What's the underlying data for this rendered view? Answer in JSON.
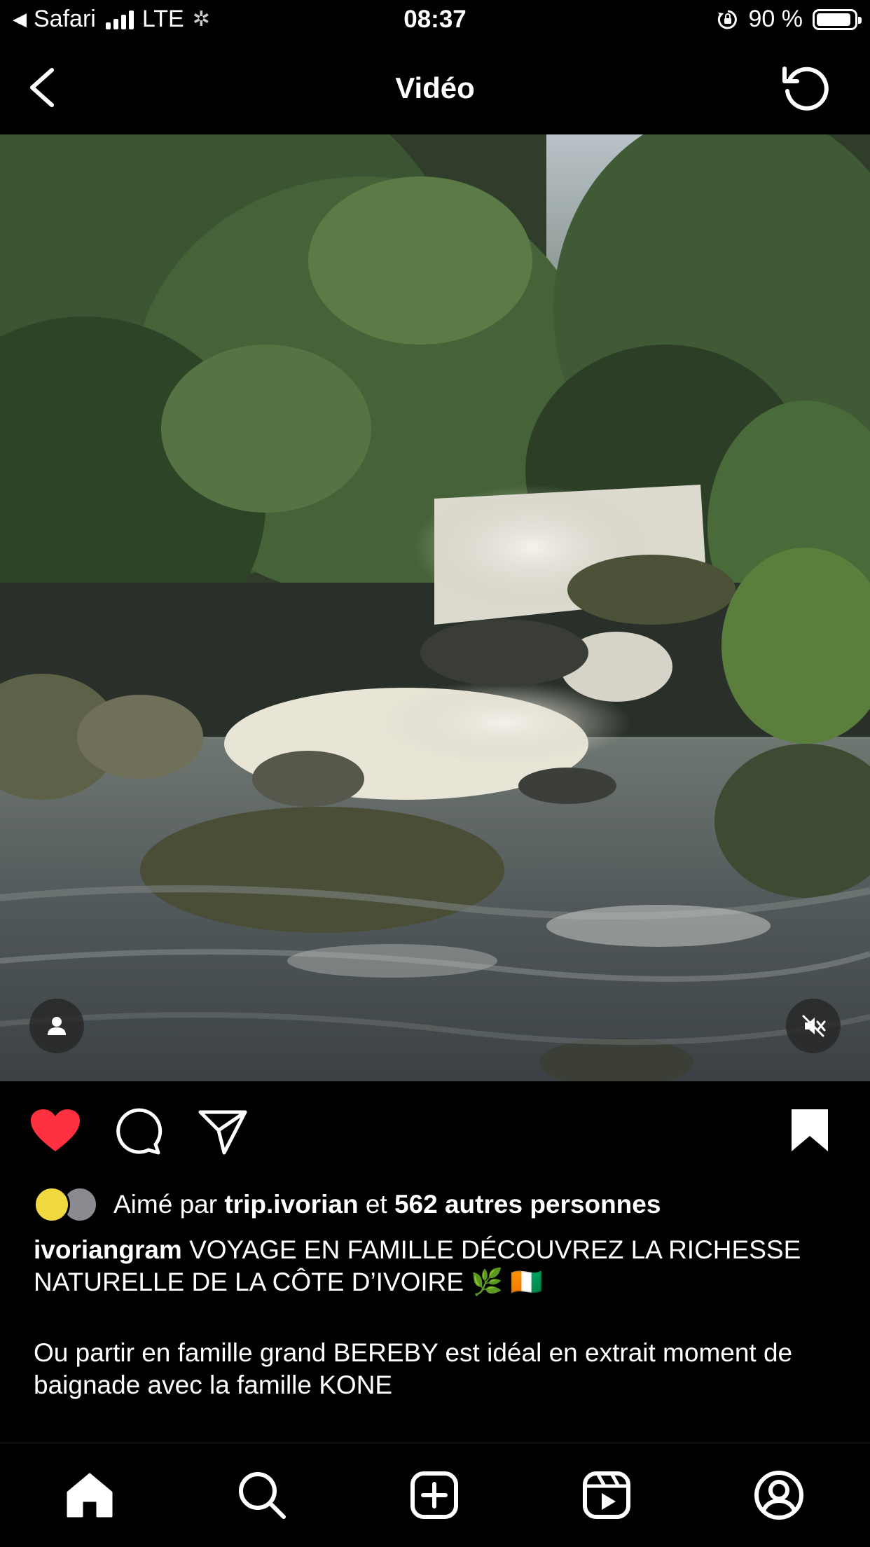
{
  "status_bar": {
    "back_app": "Safari",
    "carrier": "LTE",
    "time": "08:37",
    "battery": "90 %",
    "battery_level": 0.9
  },
  "nav": {
    "title": "Vidéo"
  },
  "icons": {
    "back": "chevron-left-icon",
    "refresh": "refresh-icon",
    "tag": "person-icon",
    "mute": "speaker-muted-icon",
    "like": "heart-filled-icon",
    "comment": "comment-icon",
    "share": "paper-plane-icon",
    "save": "bookmark-filled-icon"
  },
  "colors": {
    "like": "#ff3040",
    "background": "#000000",
    "text": "#ffffff"
  },
  "likes": {
    "prefix": "Aimé par",
    "user": "trip.ivorian",
    "connector": "et",
    "others": "562 autres personnes"
  },
  "post": {
    "username": "ivoriangram",
    "caption": "VOYAGE EN FAMILLE DÉCOUVREZ LA RICHESSE NATURELLE DE LA CÔTE D’IVOIRE 🌿 🇨🇮",
    "body": "Ou partir en famille grand BEREBY est idéal en extrait moment de baignade avec la famille KONE"
  },
  "tabbar": {
    "items": [
      "home-icon",
      "search-icon",
      "create-icon",
      "reels-icon",
      "profile-icon"
    ]
  }
}
